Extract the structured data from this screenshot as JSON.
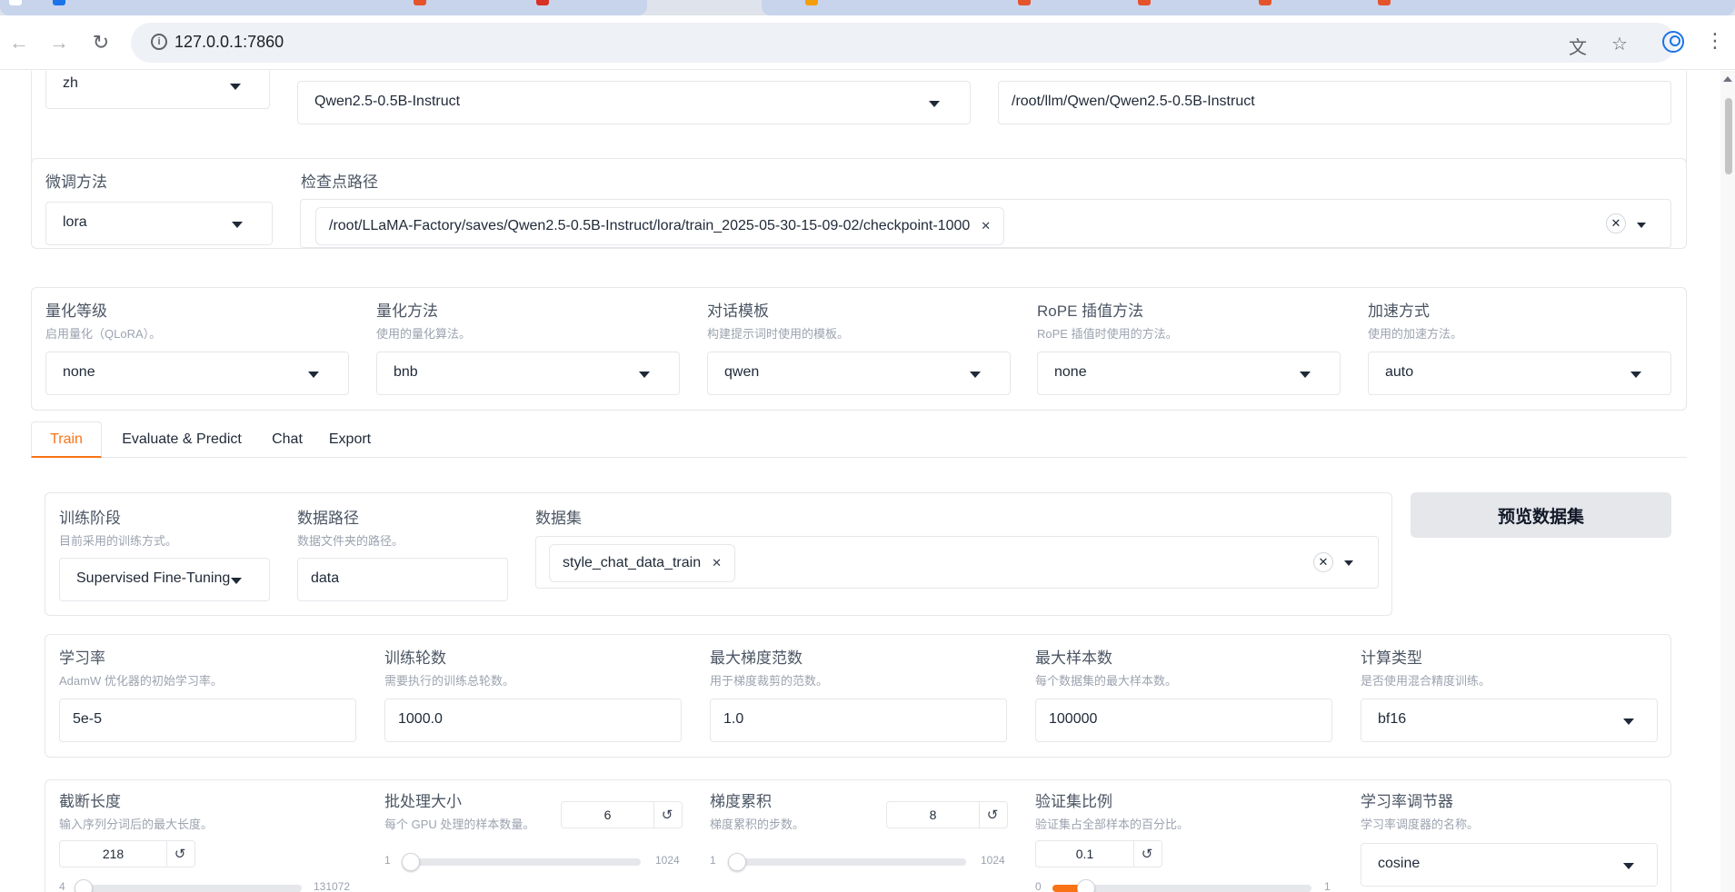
{
  "browser": {
    "url": "127.0.0.1:7860"
  },
  "model_row": {
    "lang_value": "zh",
    "model_name_value": "Qwen2.5-0.5B-Instruct",
    "model_path_value": "/root/llm/Qwen/Qwen2.5-0.5B-Instruct"
  },
  "finetune_row": {
    "method_label": "微调方法",
    "method_value": "lora",
    "checkpoint_label": "检查点路径",
    "checkpoint_chip": "/root/LLaMA-Factory/saves/Qwen2.5-0.5B-Instruct/lora/train_2025-05-30-15-09-02/checkpoint-1000"
  },
  "advanced_row": [
    {
      "label": "量化等级",
      "info": "启用量化（QLoRA）。",
      "value": "none"
    },
    {
      "label": "量化方法",
      "info": "使用的量化算法。",
      "value": "bnb"
    },
    {
      "label": "对话模板",
      "info": "构建提示词时使用的模板。",
      "value": "qwen"
    },
    {
      "label": "RoPE 插值方法",
      "info": "RoPE 插值时使用的方法。",
      "value": "none"
    },
    {
      "label": "加速方式",
      "info": "使用的加速方法。",
      "value": "auto"
    }
  ],
  "tabs": [
    "Train",
    "Evaluate & Predict",
    "Chat",
    "Export"
  ],
  "train": {
    "stage_label": "训练阶段",
    "stage_info": "目前采用的训练方式。",
    "stage_value": "Supervised Fine-Tuning",
    "data_dir_label": "数据路径",
    "data_dir_info": "数据文件夹的路径。",
    "data_dir_value": "data",
    "dataset_label": "数据集",
    "dataset_chip": "style_chat_data_train",
    "preview_button": "预览数据集",
    "hyper_row": [
      {
        "label": "学习率",
        "info": "AdamW 优化器的初始学习率。",
        "value": "5e-5"
      },
      {
        "label": "训练轮数",
        "info": "需要执行的训练总轮数。",
        "value": "1000.0"
      },
      {
        "label": "最大梯度范数",
        "info": "用于梯度裁剪的范数。",
        "value": "1.0"
      },
      {
        "label": "最大样本数",
        "info": "每个数据集的最大样本数。",
        "value": "100000"
      },
      {
        "label": "计算类型",
        "info": "是否使用混合精度训练。",
        "value": "bf16"
      }
    ],
    "cutoff": {
      "label": "截断长度",
      "info": "输入序列分词后的最大长度。",
      "value": "218",
      "min": "4",
      "max": "131072",
      "level": 0.0016
    },
    "batch": {
      "label": "批处理大小",
      "info": "每个 GPU 处理的样本数量。",
      "value": "6",
      "min": "1",
      "max": "1024",
      "level": 0.005
    },
    "grad_accum": {
      "label": "梯度累积",
      "info": "梯度累积的步数。",
      "value": "8",
      "min": "1",
      "max": "1024",
      "level": 0.007
    },
    "val_size": {
      "label": "验证集比例",
      "info": "验证集占全部样本的百分比。",
      "value": "0.1",
      "min": "0",
      "max": "1",
      "level": 0.1
    },
    "scheduler": {
      "label": "学习率调节器",
      "info": "学习率调度器的名称。",
      "value": "cosine"
    }
  },
  "colors": {
    "accent": "#f97316",
    "border": "#e5e7eb",
    "label": "#4b5563",
    "info": "#9ca3af"
  }
}
